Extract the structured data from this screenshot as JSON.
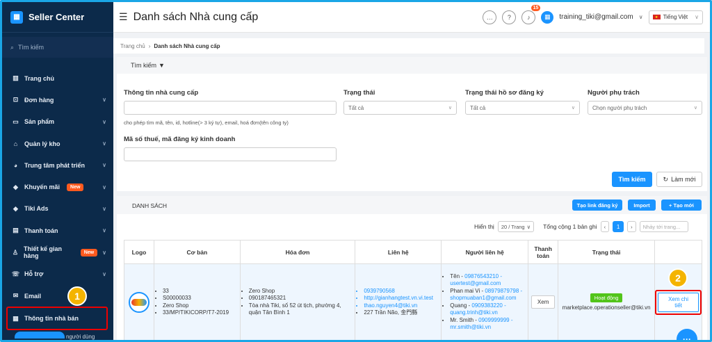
{
  "sidebar": {
    "brand": "Seller Center",
    "search_placeholder": "Tìm kiếm",
    "items": [
      {
        "label": "Trang chủ",
        "icon": "chart-icon",
        "chevron": false
      },
      {
        "label": "Đơn hàng",
        "icon": "cart-icon",
        "chevron": true
      },
      {
        "label": "Sản phẩm",
        "icon": "box-icon",
        "chevron": true
      },
      {
        "label": "Quản lý kho",
        "icon": "warehouse-icon",
        "chevron": true
      },
      {
        "label": "Trung tâm phát triển",
        "icon": "pie-icon",
        "chevron": true
      },
      {
        "label": "Khuyến mãi",
        "icon": "tag-icon",
        "chevron": true,
        "badge": "New"
      },
      {
        "label": "Tiki Ads",
        "icon": "ads-icon",
        "chevron": true
      },
      {
        "label": "Thanh toán",
        "icon": "invoice-icon",
        "chevron": true
      },
      {
        "label": "Thiết kế gian hàng",
        "icon": "design-icon",
        "chevron": true,
        "badge": "New"
      },
      {
        "label": "Hỗ trợ",
        "icon": "support-icon",
        "chevron": true
      },
      {
        "label": "Email",
        "icon": "mail-icon",
        "chevron": false
      },
      {
        "label": "Thông tin nhà bán",
        "icon": "seller-info-icon",
        "chevron": false
      }
    ],
    "bottom_partial": "người dùng",
    "step1": "1"
  },
  "header": {
    "title": "Danh sách Nhà cung cấp",
    "notif_count": "15",
    "user_email": "training_tiki@gmail.com",
    "language": "Tiếng Việt"
  },
  "breadcrumb": {
    "home": "Trang chủ",
    "current": "Danh sách Nhà cung cấp"
  },
  "search": {
    "toggle_label": "Tìm kiếm",
    "supplier_info_label": "Thông tin nhà cung cấp",
    "supplier_info_hint": "cho phép tìm mã, tên, id, hotline(> 3 ký tự), email, hoá đơn(tên công ty)",
    "status_label": "Trạng thái",
    "status_value": "Tất cả",
    "reg_status_label": "Trạng thái hồ sơ đăng ký",
    "reg_status_value": "Tất cả",
    "owner_label": "Người phụ trách",
    "owner_placeholder": "Chọn người phụ trách",
    "tax_label": "Mã số thuế, mã đăng ký kinh doanh",
    "search_button": "Tìm kiếm",
    "reset_button": "Làm mới"
  },
  "list": {
    "title": "DANH SÁCH",
    "reg_link_button": "Tạo link đăng ký",
    "import_button": "Import",
    "create_button": "+ Tạo mới",
    "show_label": "Hiển thị",
    "per_page": "20 / Trang",
    "total": "Tổng cộng 1 bản ghi",
    "current_page": "1",
    "jump_placeholder": "Nhảy tới trang...",
    "columns": [
      "Logo",
      "Cơ bản",
      "Hóa đơn",
      "Liên hệ",
      "Người liên hệ",
      "Thanh toán",
      "Trạng thái",
      ""
    ],
    "row": {
      "basic": [
        "33",
        "S00000033",
        "Zero Shop",
        "33/MP/TIKICORP/T7-2019"
      ],
      "invoice": [
        "Zero Shop",
        "090187465321",
        "Tòa nhà Tiki, số 52 út tịch, phường 4, quận Tân Bình 1"
      ],
      "contact": [
        {
          "text": "0939790568",
          "link": true
        },
        {
          "text": "http://gianhangtest.vn.vi.test",
          "link": true
        },
        {
          "text": "thao.nguyen4@tiki.vn",
          "link": true
        },
        {
          "text": "227 Trần Não, 金門縣",
          "link": false
        }
      ],
      "persons": [
        {
          "name": "Tên - ",
          "phone": "09876543210 -",
          "email": "usertest@gmail.com"
        },
        {
          "name": "Phan mai Vi - ",
          "phone": "08979879798 -",
          "email": "shopmuaban1@gmail.com"
        },
        {
          "name": "Quang - ",
          "phone": "0909383220 -",
          "email": "quang.trinh@tiki.vn"
        },
        {
          "name": "Mr. Smith - ",
          "phone": "0909999999 -",
          "email": "mr.smith@tiki.vn"
        }
      ],
      "payment_button": "Xem",
      "status_badge": "Hoạt động",
      "status_owner": "marketplace.operationseller@tiki.vn",
      "detail_button": "Xem chi tiết",
      "step2": "2"
    }
  },
  "colors": {
    "primary": "#1a94ff",
    "sidebar": "#0c2a4a",
    "highlight": "#e00000",
    "step": "#f4b400",
    "active": "#52c41a"
  }
}
